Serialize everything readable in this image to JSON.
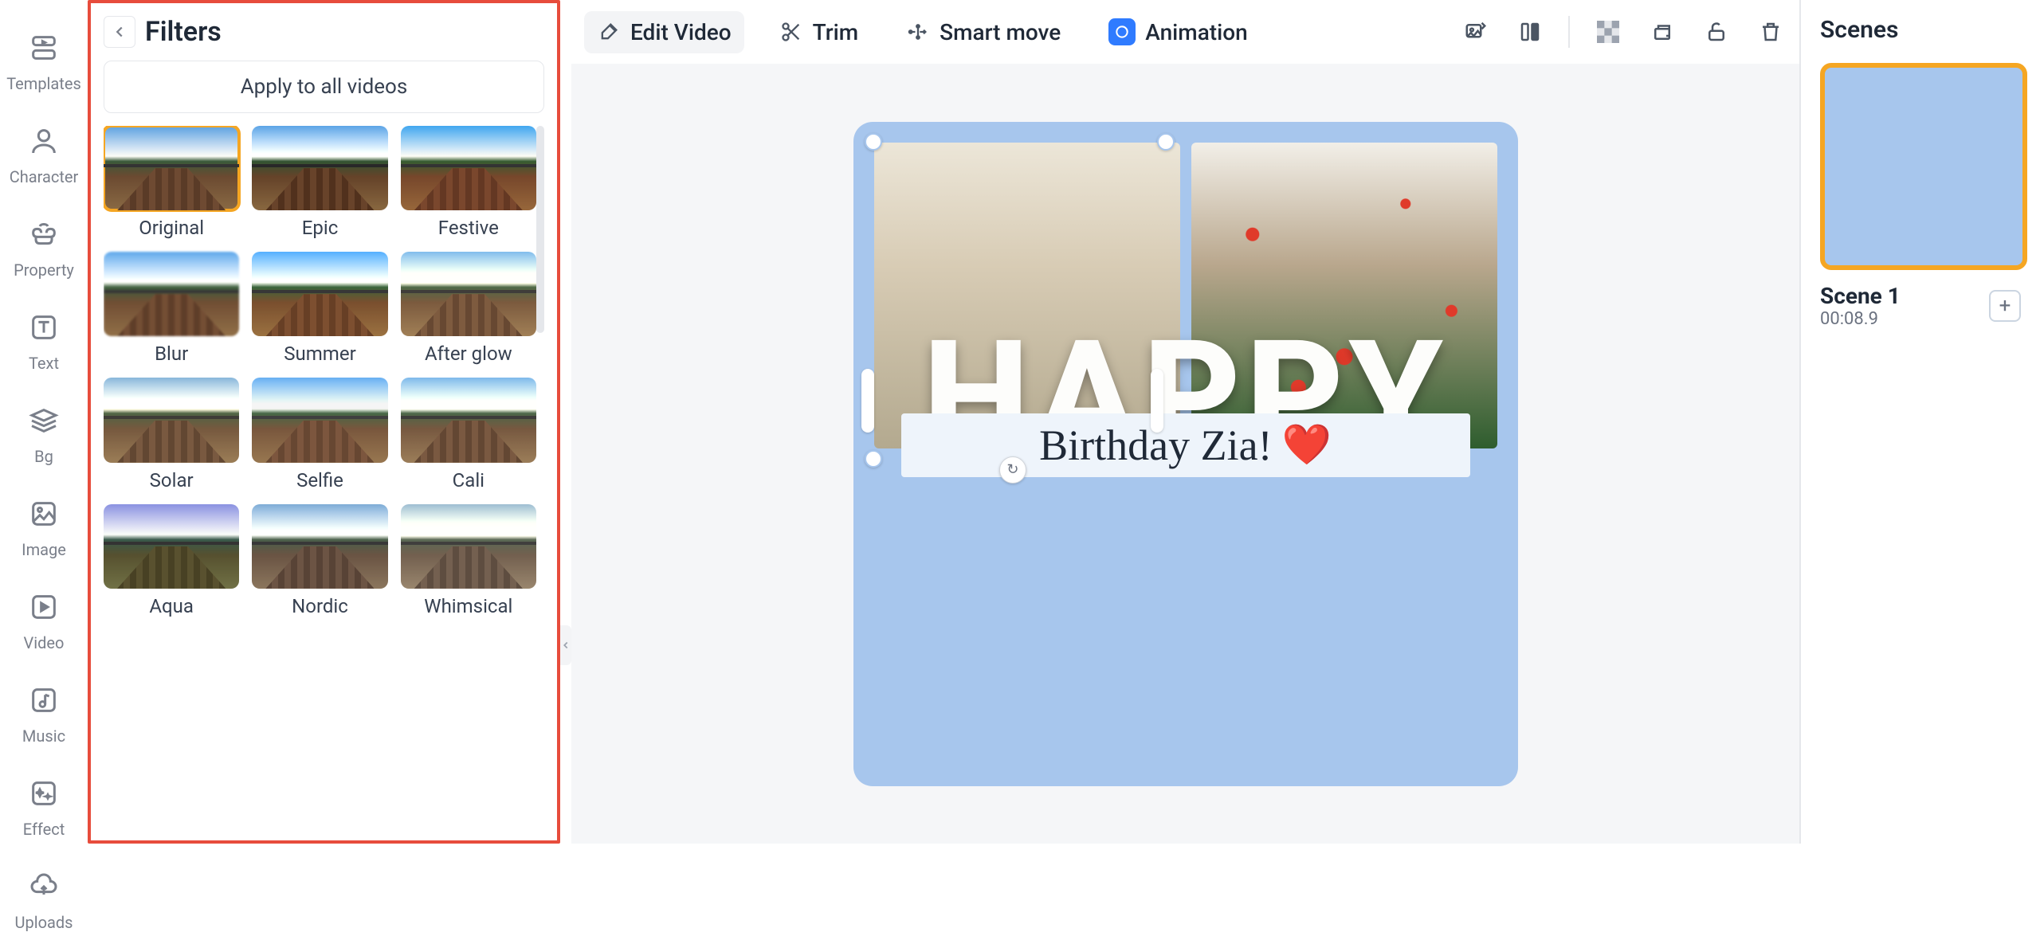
{
  "nav": {
    "items": [
      {
        "label": "Templates",
        "icon": "templates-icon"
      },
      {
        "label": "Character",
        "icon": "character-icon"
      },
      {
        "label": "Property",
        "icon": "property-icon"
      },
      {
        "label": "Text",
        "icon": "text-icon"
      },
      {
        "label": "Bg",
        "icon": "bg-icon"
      },
      {
        "label": "Image",
        "icon": "image-icon"
      },
      {
        "label": "Video",
        "icon": "video-icon"
      },
      {
        "label": "Music",
        "icon": "music-icon"
      },
      {
        "label": "Effect",
        "icon": "effect-icon"
      },
      {
        "label": "Uploads",
        "icon": "uploads-icon"
      }
    ]
  },
  "filters": {
    "title": "Filters",
    "apply_all": "Apply to all videos",
    "items": [
      {
        "label": "Original",
        "selected": true,
        "cls": ""
      },
      {
        "label": "Epic",
        "cls": "filt-epic"
      },
      {
        "label": "Festive",
        "cls": "filt-festive"
      },
      {
        "label": "Blur",
        "cls": "filt-blur"
      },
      {
        "label": "Summer",
        "cls": "filt-summer"
      },
      {
        "label": "After glow",
        "cls": "filt-afterglow"
      },
      {
        "label": "Solar",
        "cls": "filt-solar"
      },
      {
        "label": "Selfie",
        "cls": "filt-selfie"
      },
      {
        "label": "Cali",
        "cls": "filt-cali"
      },
      {
        "label": "Aqua",
        "cls": "filt-aqua"
      },
      {
        "label": "Nordic",
        "cls": "filt-nordic"
      },
      {
        "label": "Whimsical",
        "cls": "filt-whimsical"
      }
    ]
  },
  "toolbar": {
    "edit_video": "Edit Video",
    "trim": "Trim",
    "smart_move": "Smart move",
    "animation": "Animation"
  },
  "canvas": {
    "big_text": "HAPPY",
    "subtitle": "Birthday Zia!",
    "heart": "❤️"
  },
  "scenes": {
    "title": "Scenes",
    "items": [
      {
        "name": "Scene 1",
        "time": "00:08.9"
      }
    ]
  }
}
